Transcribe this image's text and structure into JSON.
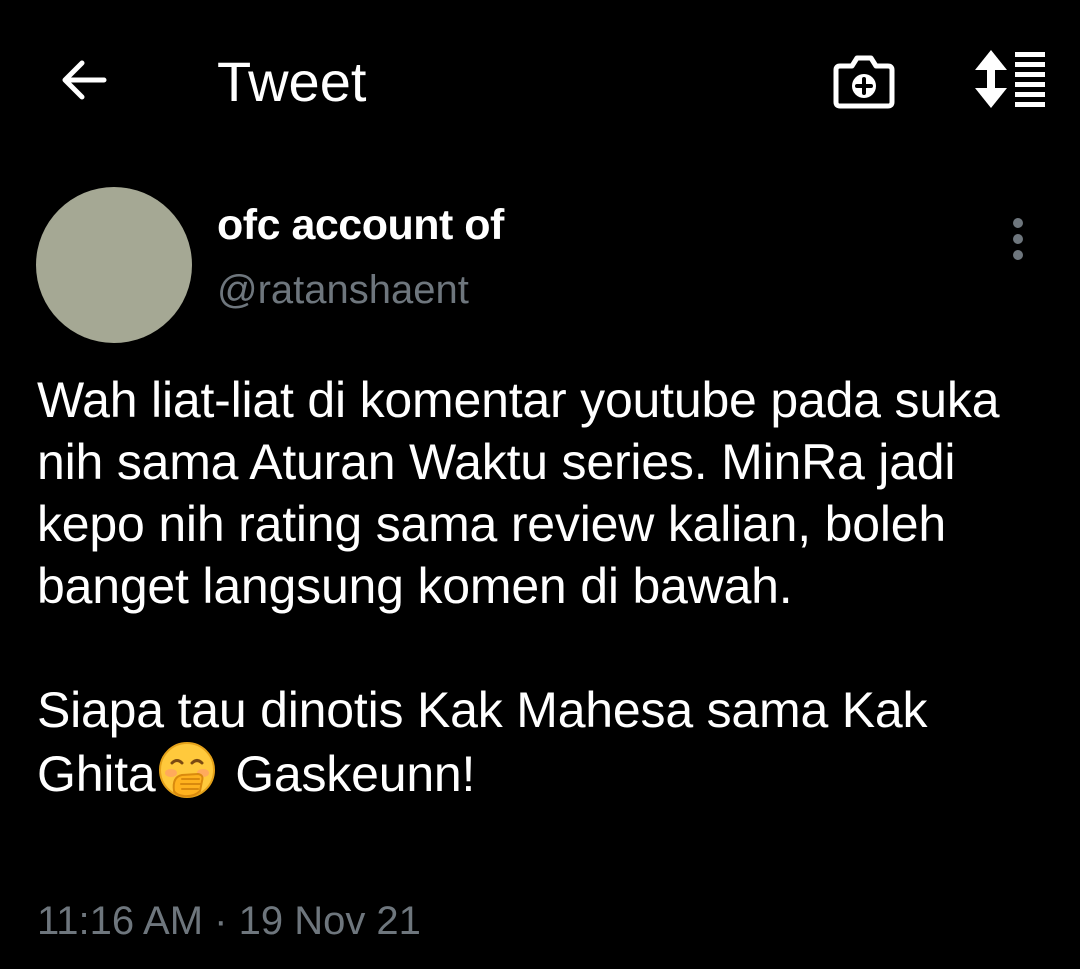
{
  "header": {
    "title": "Tweet",
    "back_icon": "arrow-left-icon",
    "camera_icon": "camera-add-icon",
    "sort_icon": "sort-list-icon"
  },
  "tweet": {
    "display_name": "ofc account of",
    "handle": "@ratanshaent",
    "paragraph1": "Wah liat-liat di komentar youtube pada suka nih sama Aturan Waktu series. MinRa jadi kepo nih rating sama review kalian, boleh banget langsung komen di bawah.",
    "paragraph2_before": "Siapa tau dinotis Kak Mahesa sama Kak Ghita",
    "emoji": "hand-over-mouth-emoji",
    "paragraph2_after": " Gaskeunn!",
    "timestamp": "11:16 AM · 19 Nov 21"
  },
  "colors": {
    "background": "#000000",
    "text": "#ffffff",
    "secondary_text": "#6e767d",
    "avatar": "#a5a894"
  }
}
